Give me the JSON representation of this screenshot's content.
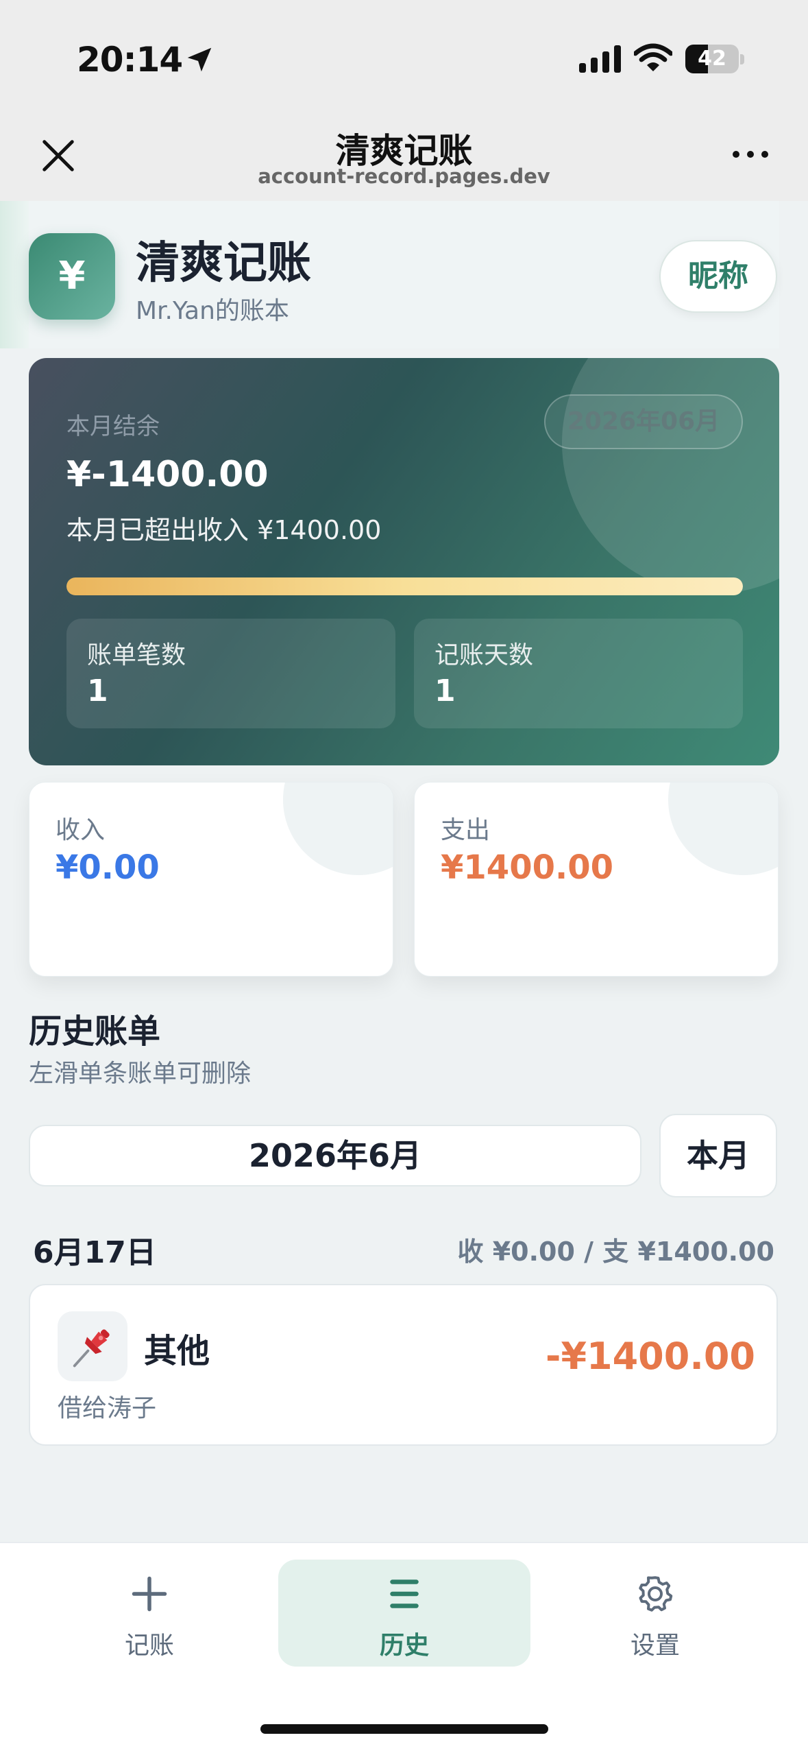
{
  "status_bar": {
    "time": "20:14",
    "battery": "42",
    "battery_level": 0.42,
    "icons": [
      "location-arrow-icon",
      "signal-icon",
      "wifi-icon",
      "battery-icon"
    ]
  },
  "browser": {
    "title": "清爽记账",
    "url": "account-record.pages.dev",
    "icons": [
      "close-icon",
      "more-icon"
    ]
  },
  "header": {
    "logo_symbol": "¥",
    "title": "清爽记账",
    "subtitle": "Mr.Yan的账本",
    "nickname_button": "昵称"
  },
  "balance_card": {
    "label": "本月结余",
    "month_badge": "2026年06月",
    "amount": "¥-1400.00",
    "note": "本月已超出收入 ¥1400.00",
    "progress": 1.0,
    "stats": [
      {
        "label": "账单笔数",
        "value": "1"
      },
      {
        "label": "记账天数",
        "value": "1"
      }
    ]
  },
  "summary": {
    "income_label": "收入",
    "income_value": "¥0.00",
    "expense_label": "支出",
    "expense_value": "¥1400.00"
  },
  "history": {
    "title": "历史账单",
    "hint": "左滑单条账单可删除",
    "month_selector": "2026年6月",
    "this_month_button": "本月",
    "groups": [
      {
        "date": "6月17日",
        "summary": "收 ¥0.00 / 支 ¥1400.00",
        "records": [
          {
            "icon": "pushpin-icon",
            "category": "其他",
            "note": "借给涛子",
            "amount": "-¥1400.00"
          }
        ]
      }
    ]
  },
  "tabs": [
    {
      "label": "记账",
      "icon": "plus-icon",
      "active": false
    },
    {
      "label": "历史",
      "icon": "list-icon",
      "active": true
    },
    {
      "label": "设置",
      "icon": "gear-icon",
      "active": false
    }
  ],
  "colors": {
    "accent": "#2f7f69",
    "income": "#3a78e6",
    "expense": "#e6784a",
    "card_gradient_start": "#48505f",
    "card_gradient_end": "#3f8a76"
  }
}
